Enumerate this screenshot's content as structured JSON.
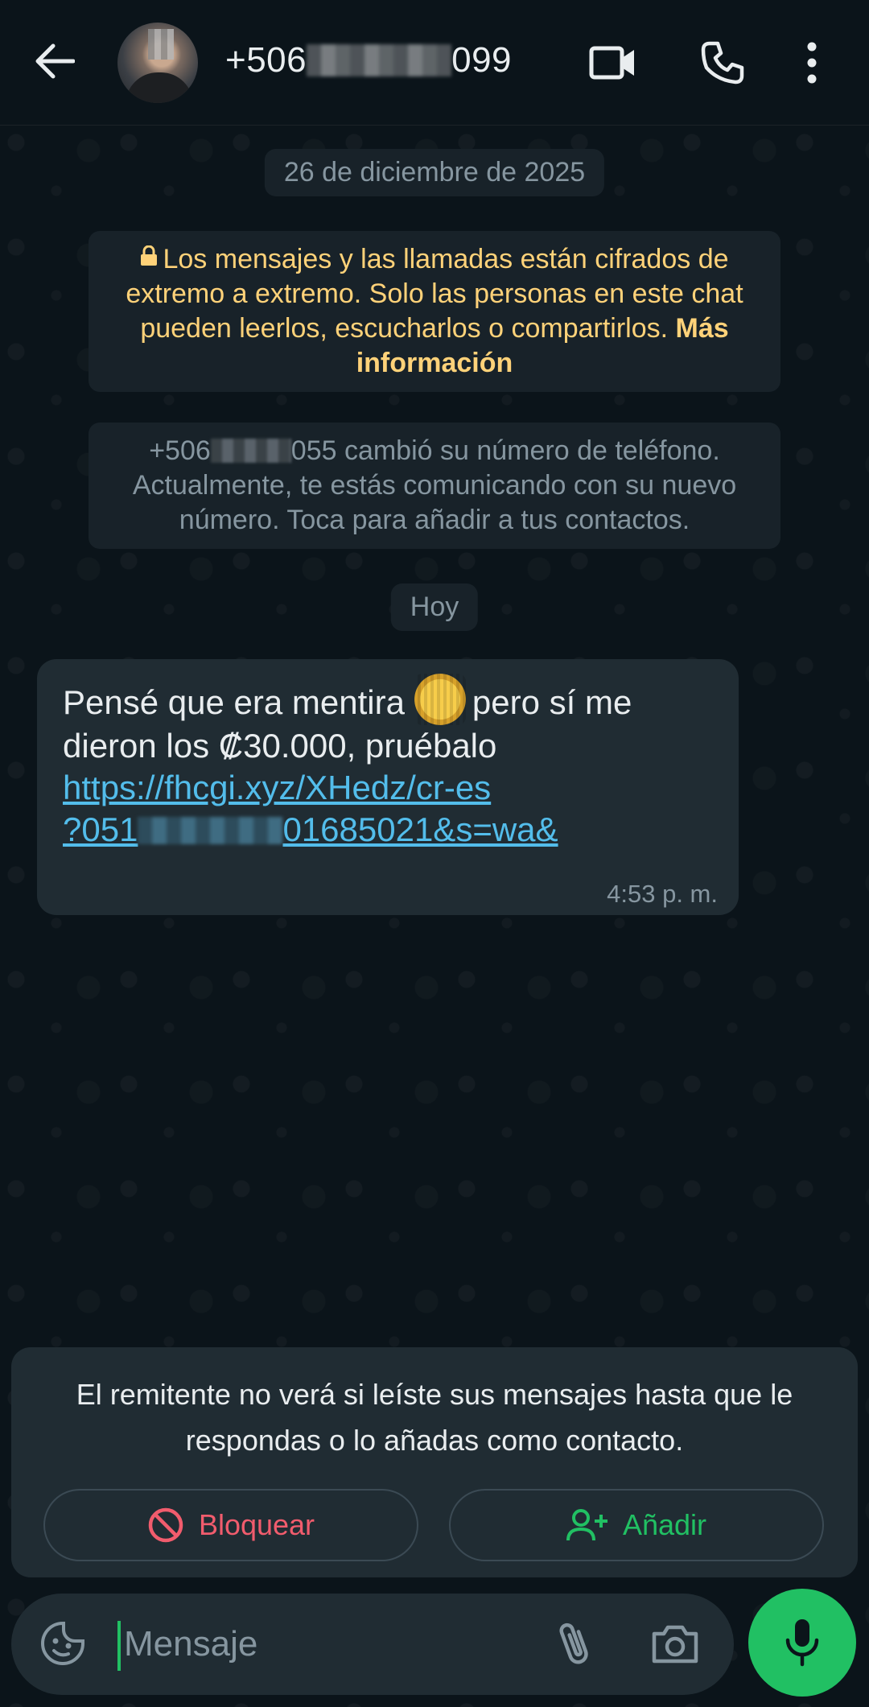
{
  "header": {
    "phone_prefix": "+506",
    "phone_suffix": "099",
    "icons": [
      "back-arrow-icon",
      "video-call-icon",
      "phone-icon",
      "more-vert-icon"
    ]
  },
  "chat": {
    "date_label": "26 de diciembre de 2025",
    "encryption_notice": {
      "text": "Los mensajes y las llamadas están cifrados de extremo a extremo. Solo las personas en este chat pueden leerlos, escucharlos o compartirlos.",
      "link": "Más información",
      "color": "#ffd279"
    },
    "number_change_notice": {
      "prefix": "+506",
      "suffix": "055 cambió su número de teléfono. Actualmente, te estás comunicando con su nuevo número. Toca para añadir a tus contactos."
    },
    "today_label": "Hoy",
    "message": {
      "text_before_emoji": "Pensé que era mentira",
      "text_after_emoji": "pero sí me dieron los ₡30.000, pruébalo",
      "link_line1": "https://fhcgi.xyz/XHedz/cr-es",
      "link_line2_prefix": "?051",
      "link_line2_suffix": "01685021&s=wa&",
      "time": "4:53 p. m."
    }
  },
  "unknown_sender_card": {
    "message": "El remitente no verá si leíste sus mensajes hasta que le respondas o lo añadas como contacto.",
    "block_label": "Bloquear",
    "add_label": "Añadir",
    "block_color": "#f15c6d",
    "add_color": "#21c063"
  },
  "composer": {
    "placeholder": "Mensaje",
    "accent": "#21c063"
  }
}
